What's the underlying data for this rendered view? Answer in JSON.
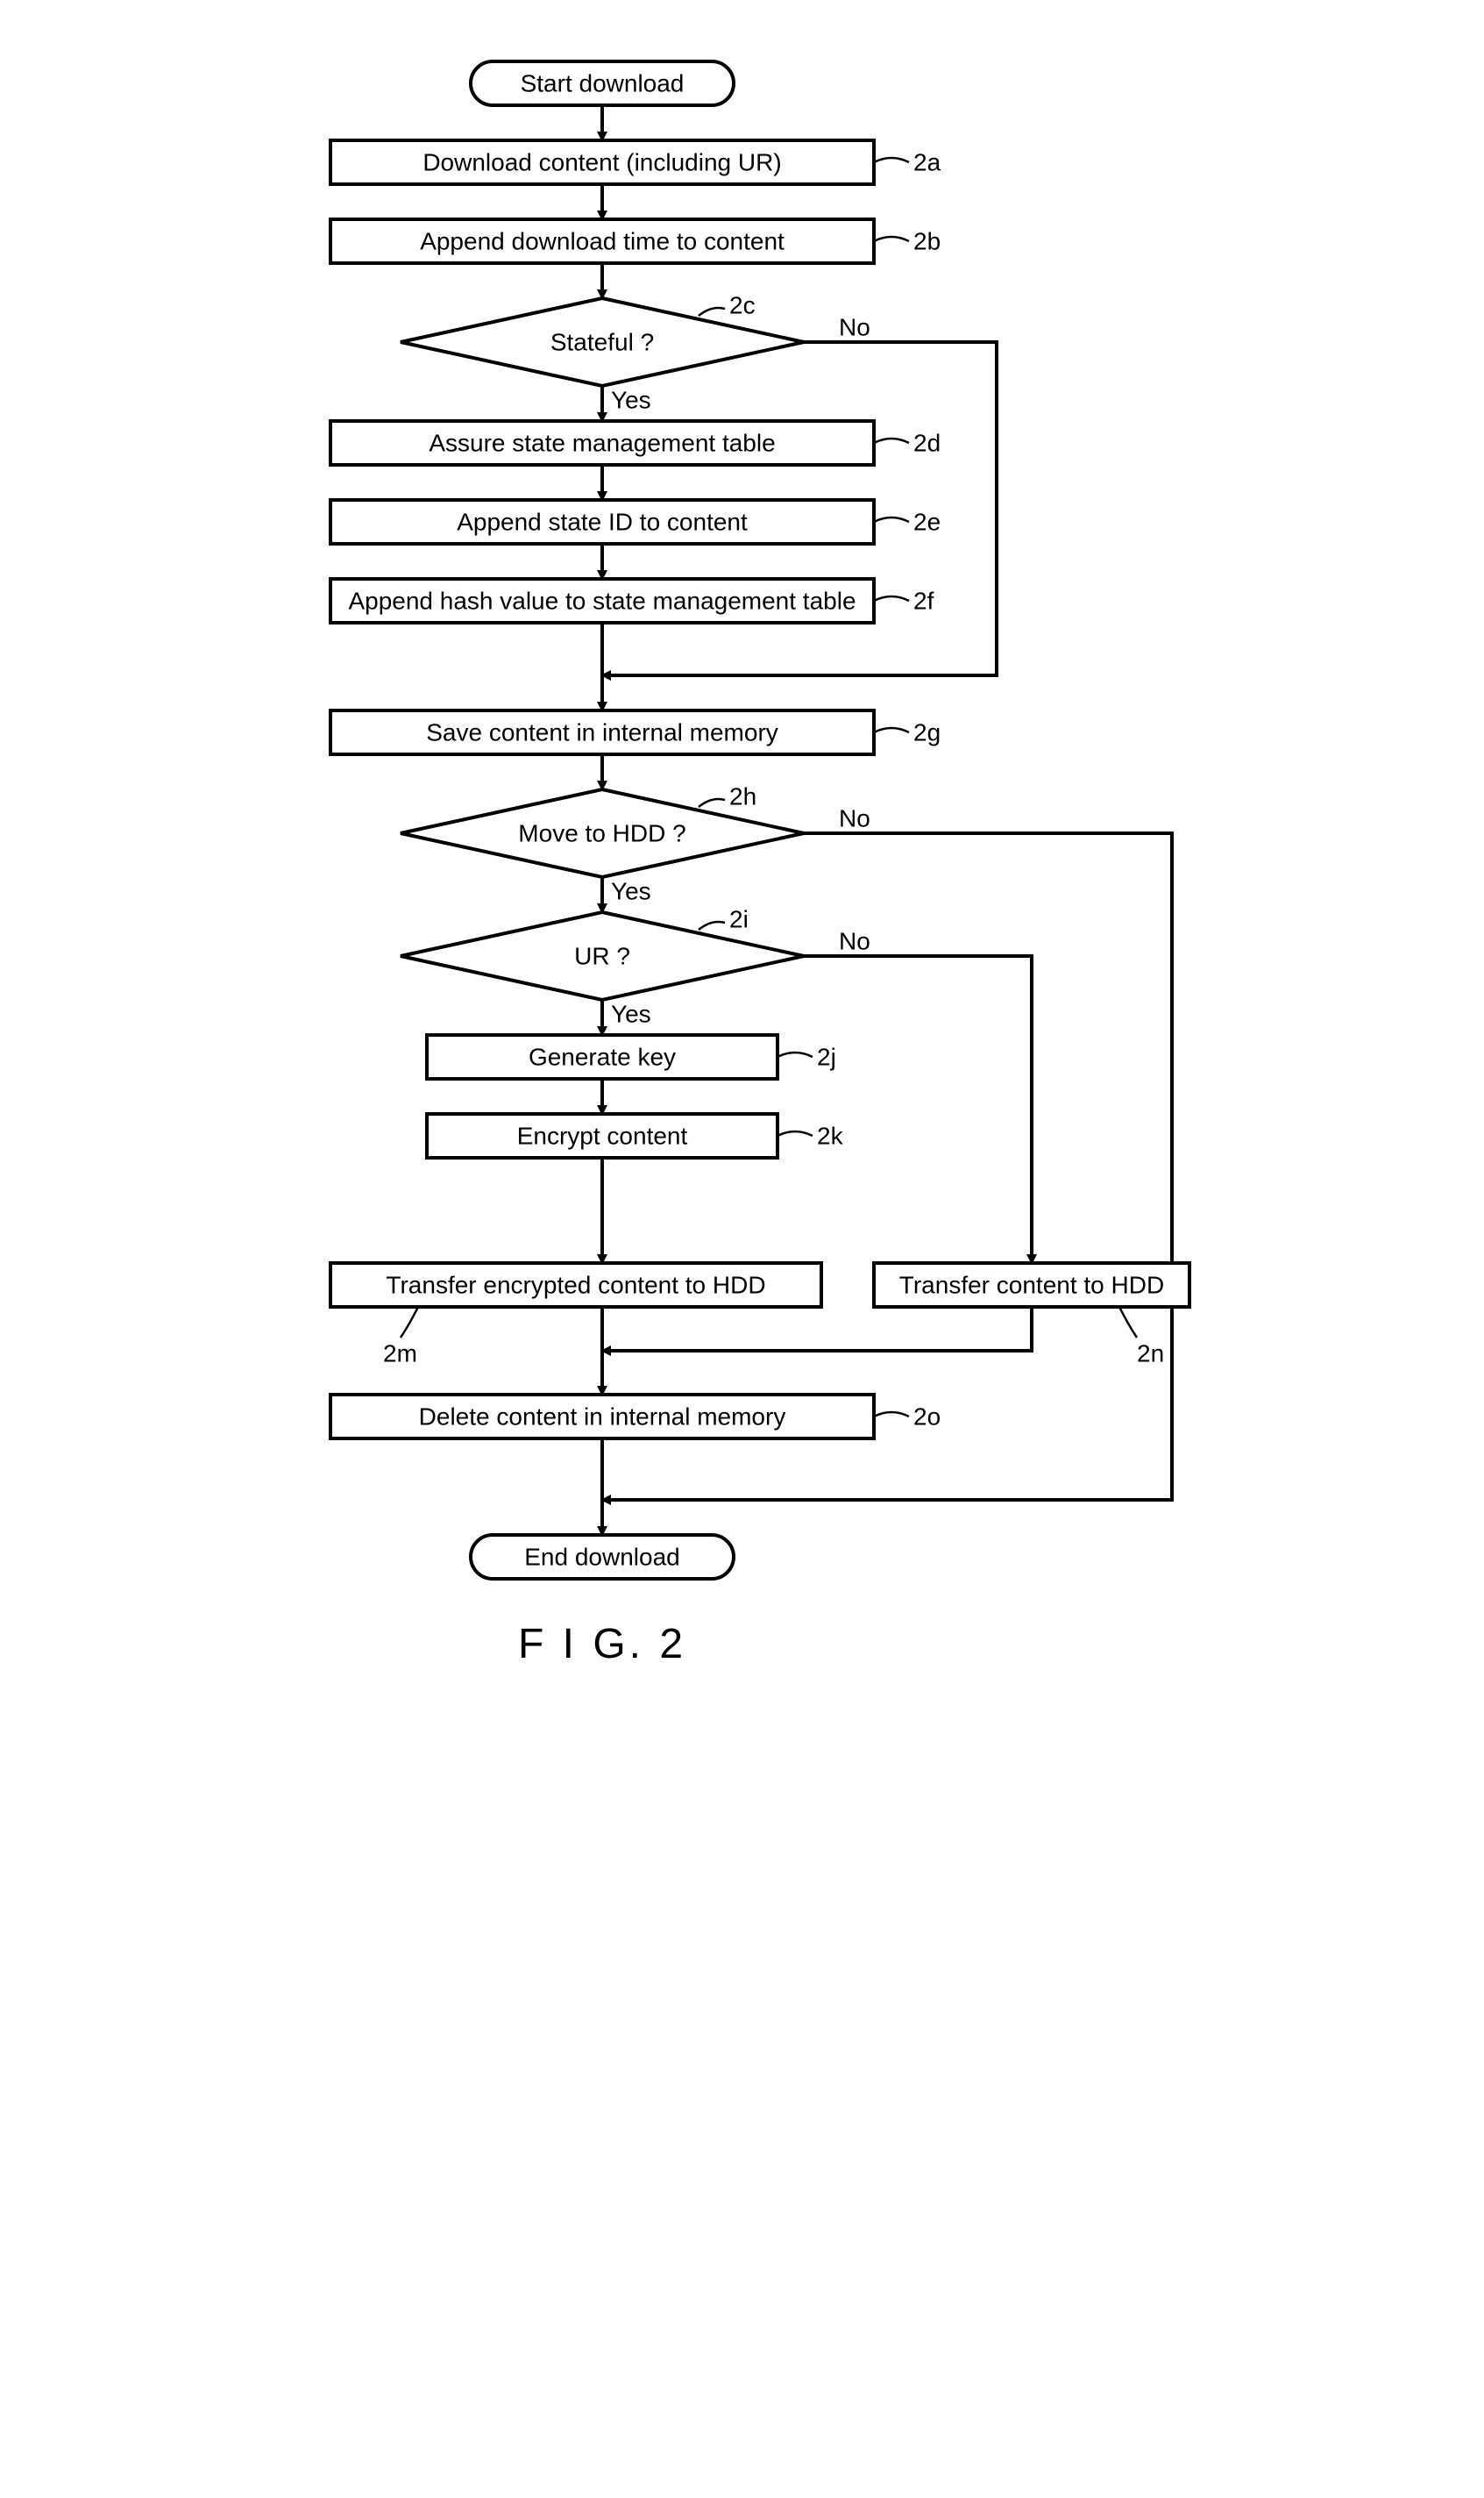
{
  "terminals": {
    "start": "Start download",
    "end": "End download"
  },
  "processes": {
    "p2a": "Download content (including UR)",
    "p2b": "Append download time to content",
    "p2d": "Assure state management table",
    "p2e": "Append state ID to content",
    "p2f": "Append hash value to state management table",
    "p2g": "Save content in internal memory",
    "p2j": "Generate key",
    "p2k": "Encrypt content",
    "p2m": "Transfer encrypted content to HDD",
    "p2n": "Transfer content to HDD",
    "p2o": "Delete content in internal memory"
  },
  "decisions": {
    "d2c": "Stateful ?",
    "d2h": "Move to HDD ?",
    "d2i": "UR ?"
  },
  "labels": {
    "l2a": "2a",
    "l2b": "2b",
    "l2c": "2c",
    "l2d": "2d",
    "l2e": "2e",
    "l2f": "2f",
    "l2g": "2g",
    "l2h": "2h",
    "l2i": "2i",
    "l2j": "2j",
    "l2k": "2k",
    "l2m": "2m",
    "l2n": "2n",
    "l2o": "2o"
  },
  "branches": {
    "yes": "Yes",
    "no": "No"
  },
  "figure": "F I G. 2"
}
